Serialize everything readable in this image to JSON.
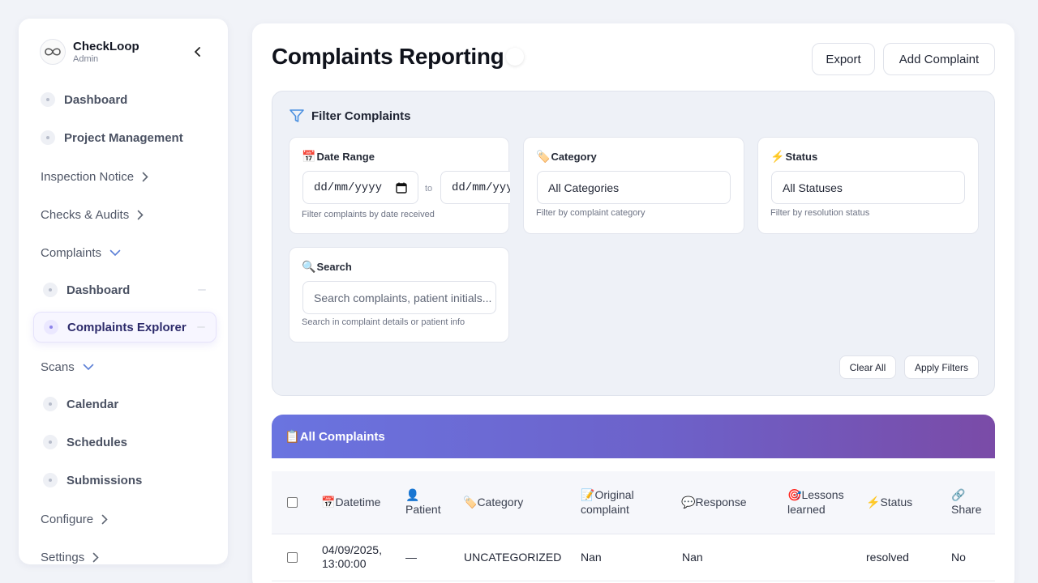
{
  "brand": {
    "name": "CheckLoop",
    "role": "Admin"
  },
  "sidebar": {
    "items": [
      {
        "label": "Dashboard"
      },
      {
        "label": "Project Management"
      },
      {
        "label": "Inspection Notice"
      },
      {
        "label": "Checks & Audits"
      },
      {
        "label": "Complaints"
      },
      {
        "label": "Dashboard"
      },
      {
        "label": "Complaints Explorer"
      },
      {
        "label": "Scans"
      },
      {
        "label": "Calendar"
      },
      {
        "label": "Schedules"
      },
      {
        "label": "Submissions"
      },
      {
        "label": "Configure"
      },
      {
        "label": "Settings"
      }
    ]
  },
  "header": {
    "title": "Complaints Reporting",
    "export_label": "Export",
    "add_label": "Add Complaint"
  },
  "filters": {
    "title": "Filter Complaints",
    "date": {
      "label": "Date Range",
      "emoji": "📅",
      "from": "dd/mm/yyyy",
      "to_word": "to",
      "to": "dd/mm/yyyy",
      "help": "Filter complaints by date received"
    },
    "category": {
      "label": "Category",
      "emoji": "🏷️",
      "value": "All Categories",
      "help": "Filter by complaint category"
    },
    "status": {
      "label": "Status",
      "emoji": "⚡",
      "value": "All Statuses",
      "help": "Filter by resolution status"
    },
    "search": {
      "label": "Search",
      "emoji": "🔍",
      "placeholder": "Search complaints, patient initials...",
      "help": "Search in complaint details or patient info"
    },
    "clear_label": "Clear All",
    "apply_label": "Apply Filters"
  },
  "table": {
    "title": "All Complaints",
    "title_emoji": "📋",
    "columns": [
      {
        "emoji": "📅",
        "label": "Datetime"
      },
      {
        "emoji": "👤",
        "label": "Patient"
      },
      {
        "emoji": "🏷️",
        "label": "Category"
      },
      {
        "emoji": "📝",
        "label": "Original complaint"
      },
      {
        "emoji": "💬",
        "label": "Response"
      },
      {
        "emoji": "🎯",
        "label": "Lessons learned"
      },
      {
        "emoji": "⚡",
        "label": "Status"
      },
      {
        "emoji": "🔗",
        "label": "Share"
      }
    ],
    "rows": [
      {
        "datetime": "04/09/2025, 13:00:00",
        "patient": "—",
        "category": "UNCATEGORIZED",
        "original": "Nan",
        "response": "Nan",
        "lessons": "",
        "status": "resolved",
        "share": "No"
      }
    ]
  }
}
